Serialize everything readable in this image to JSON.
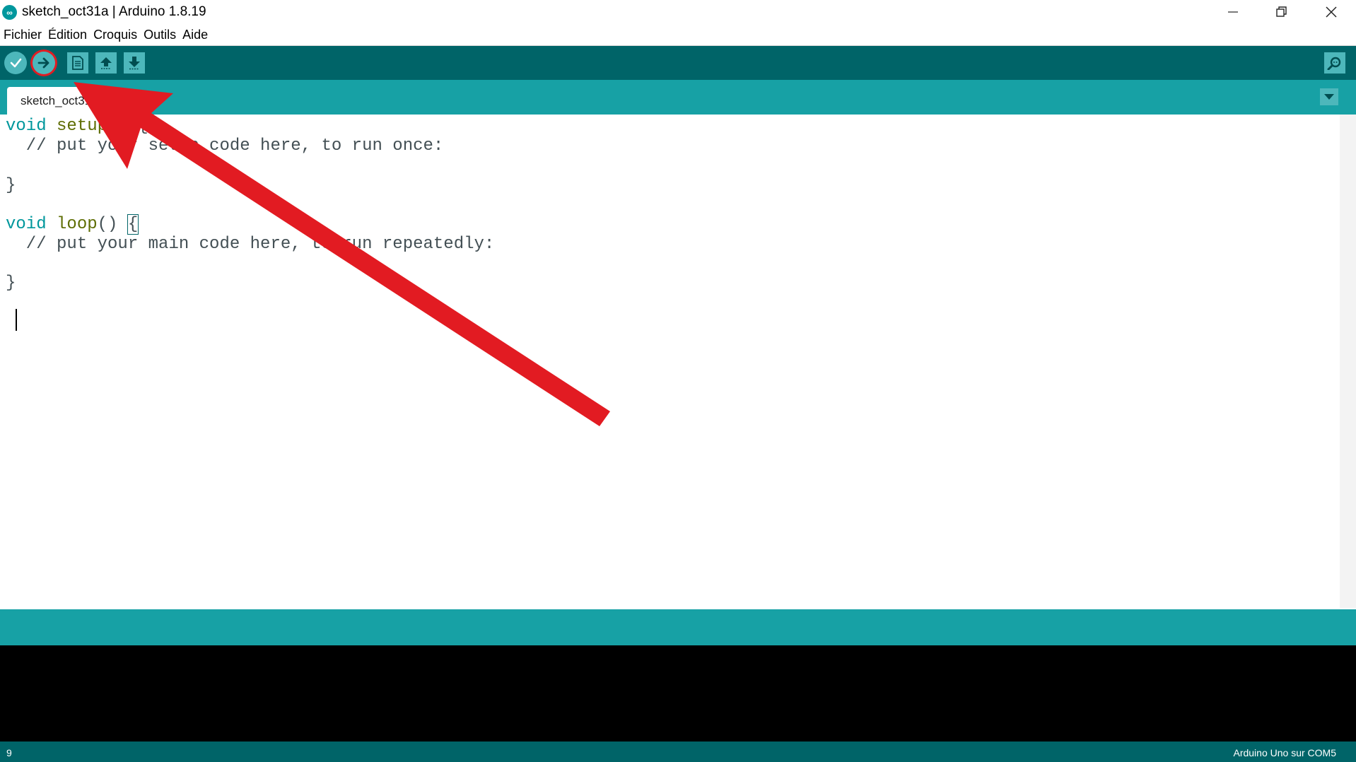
{
  "window": {
    "title": "sketch_oct31a | Arduino 1.8.19",
    "logo_glyph": "∞"
  },
  "menu": [
    "Fichier",
    "Édition",
    "Croquis",
    "Outils",
    "Aide"
  ],
  "toolbar": {
    "buttons": [
      {
        "name": "verify",
        "icon": "check-icon"
      },
      {
        "name": "upload",
        "icon": "arrow-right-icon",
        "highlighted": true,
        "highlight_color": "#e21b22"
      },
      {
        "name": "new",
        "icon": "file-icon"
      },
      {
        "name": "open",
        "icon": "arrow-up-icon"
      },
      {
        "name": "save",
        "icon": "arrow-down-icon"
      },
      {
        "name": "serial-monitor",
        "icon": "magnifier-icon"
      }
    ]
  },
  "tabs": [
    {
      "label": "sketch_oct31a"
    }
  ],
  "editor": {
    "lines": [
      {
        "t1": "void",
        "t2": " setup",
        "t3": "() {"
      },
      {
        "comment": "  // put your setup code here, to run once:"
      },
      {
        "plain": ""
      },
      {
        "plain": "}"
      },
      {
        "plain": ""
      },
      {
        "t1": "void",
        "t2": " loop",
        "t3": "() ",
        "t4": "{"
      },
      {
        "comment": "  // put your main code here, to run repeatedly:"
      },
      {
        "plain": ""
      },
      {
        "plain": "}"
      }
    ]
  },
  "status": {
    "line_number": "9",
    "board": "Arduino Uno sur COM5"
  },
  "colors": {
    "toolbar": "#006468",
    "tabstrip": "#17a1a5",
    "button": "#4db7bb",
    "keyword": "#00979c",
    "function": "#5e6d03",
    "comment": "#434f54",
    "annotation_arrow": "#e21b22"
  }
}
